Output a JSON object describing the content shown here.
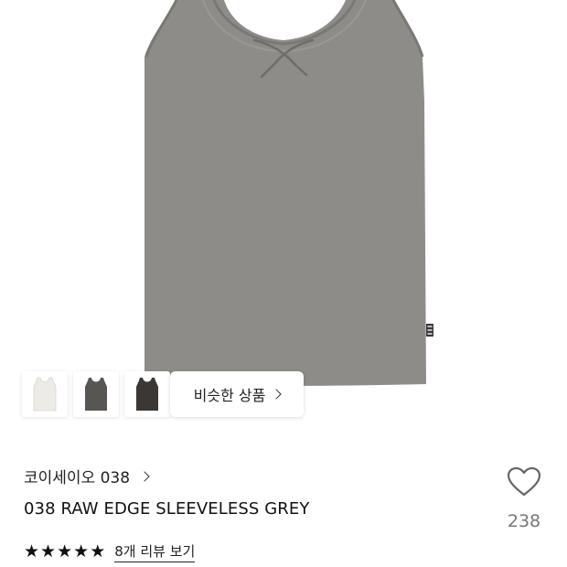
{
  "colors": {
    "garment": "#8e8c88",
    "garment_dark": "#7a7874",
    "thumb_ivory": "#ecebe5",
    "thumb_charcoal": "#585652",
    "thumb_black": "#3a3734",
    "star": "#111111",
    "like_count": "#777777"
  },
  "thumbnails": [
    {
      "icon": "ivory-tank-top-thumbnail"
    },
    {
      "icon": "charcoal-tank-top-thumbnail"
    },
    {
      "icon": "black-tank-top-thumbnail"
    }
  ],
  "similar_products": {
    "label": "비슷한 상품",
    "icon": "chevron-right-icon"
  },
  "brand": {
    "label": "코이세이오 038",
    "icon": "chevron-right-icon"
  },
  "product": {
    "name": "038 RAW EDGE SLEEVELESS GREY"
  },
  "rating": {
    "stars": 5,
    "max_stars": 5,
    "review_link": "8개 리뷰 보기"
  },
  "like": {
    "icon": "heart-outline-icon",
    "count": "238"
  }
}
